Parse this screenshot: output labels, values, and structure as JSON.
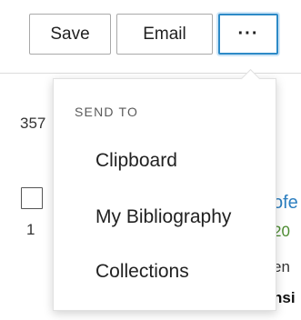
{
  "toolbar": {
    "save_label": "Save",
    "email_label": "Email",
    "more_label": "···"
  },
  "results": {
    "count_partial": "357",
    "first_index": "1"
  },
  "background_peek": {
    "title_partial": "ofe",
    "date_partial": "20",
    "author_partial": "en",
    "source_partial": "nsi"
  },
  "send_to_menu": {
    "heading": "SEND TO",
    "items": [
      {
        "label": "Clipboard"
      },
      {
        "label": "My Bibliography"
      },
      {
        "label": "Collections"
      }
    ]
  },
  "colors": {
    "accent": "#2d8ac7",
    "link": "#2d7fc0",
    "date_green": "#4a8a2e"
  }
}
